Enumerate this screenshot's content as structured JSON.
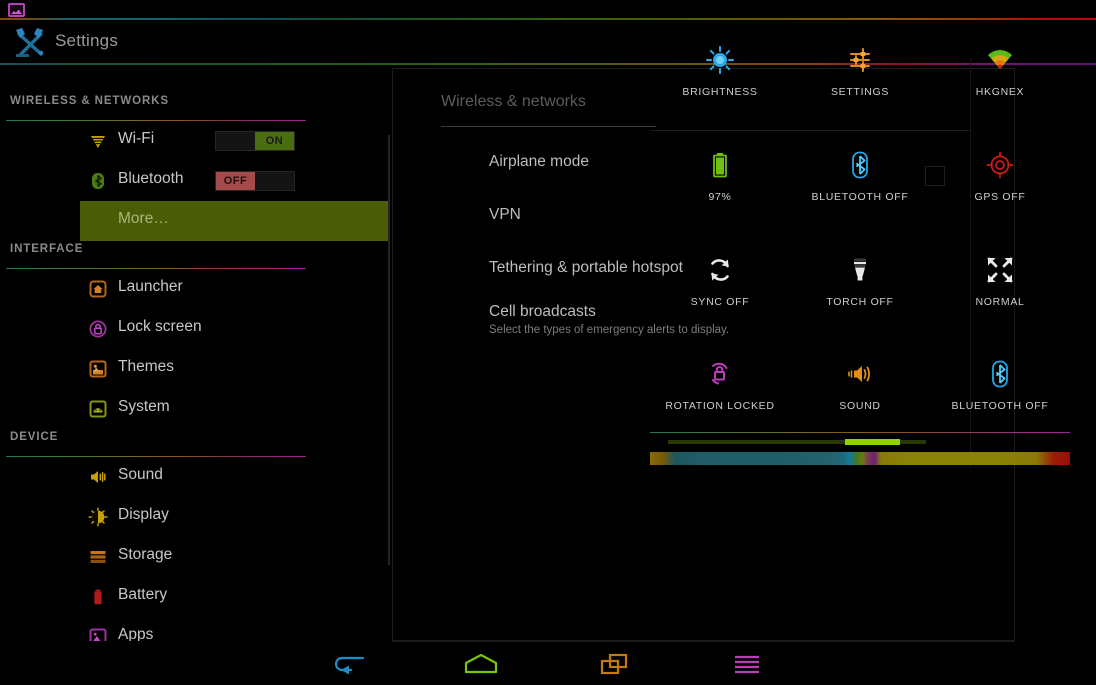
{
  "statusbar": {
    "icon": "gallery-image-icon"
  },
  "actionbar": {
    "icon": "settings-tools-icon",
    "title": "Settings"
  },
  "sidebar": {
    "sections": [
      {
        "header": "WIRELESS & NETWORKS",
        "items": [
          {
            "label": "Wi-Fi",
            "icon": "wifi-icon",
            "toggle": "ON"
          },
          {
            "label": "Bluetooth",
            "icon": "bluetooth-icon",
            "toggle": "OFF"
          },
          {
            "label": "More…",
            "icon": "none",
            "toggle": null,
            "active": true
          }
        ]
      },
      {
        "header": "INTERFACE",
        "items": [
          {
            "label": "Launcher",
            "icon": "launcher-home-icon"
          },
          {
            "label": "Lock screen",
            "icon": "lock-icon"
          },
          {
            "label": "Themes",
            "icon": "themes-picture-icon"
          },
          {
            "label": "System",
            "icon": "system-android-icon"
          }
        ]
      },
      {
        "header": "DEVICE",
        "items": [
          {
            "label": "Sound",
            "icon": "sound-speaker-icon"
          },
          {
            "label": "Display",
            "icon": "display-brightness-icon"
          },
          {
            "label": "Storage",
            "icon": "storage-icon"
          },
          {
            "label": "Battery",
            "icon": "battery-icon"
          },
          {
            "label": "Apps",
            "icon": "apps-picture-icon"
          }
        ]
      }
    ]
  },
  "content": {
    "title": "Wireless & networks",
    "prefs": [
      {
        "title": "Airplane mode",
        "sub": null
      },
      {
        "title": "VPN",
        "sub": null
      },
      {
        "title": "Tethering & portable hotspot",
        "sub": null
      },
      {
        "title": "Cell broadcasts",
        "sub": "Select the types of emergency alerts to display."
      }
    ]
  },
  "quick_settings": {
    "tiles": [
      {
        "label": "BRIGHTNESS",
        "icon": "brightness-sun-icon",
        "row": 0,
        "col": 0
      },
      {
        "label": "SETTINGS",
        "icon": "sliders-settings-icon",
        "row": 0,
        "col": 1
      },
      {
        "label": "HKGNEX",
        "icon": "wifi-signal-icon",
        "row": 0,
        "col": 2
      },
      {
        "label": "97%",
        "icon": "battery-full-icon",
        "row": 1,
        "col": 0
      },
      {
        "label": "BLUETOOTH OFF",
        "icon": "bluetooth-icon",
        "row": 1,
        "col": 1
      },
      {
        "label": "GPS OFF",
        "icon": "gps-crosshair-icon",
        "row": 1,
        "col": 2
      },
      {
        "label": "SYNC OFF",
        "icon": "sync-refresh-icon",
        "row": 2,
        "col": 0
      },
      {
        "label": "TORCH OFF",
        "icon": "torch-flashlight-icon",
        "row": 2,
        "col": 1
      },
      {
        "label": "NORMAL",
        "icon": "expand-arrows-icon",
        "row": 2,
        "col": 2
      },
      {
        "label": "ROTATION LOCKED",
        "icon": "rotation-lock-icon",
        "row": 3,
        "col": 0
      },
      {
        "label": "SOUND",
        "icon": "volume-sound-icon",
        "row": 3,
        "col": 1
      },
      {
        "label": "BLUETOOTH OFF",
        "icon": "bluetooth-icon",
        "row": 3,
        "col": 2
      }
    ],
    "brightness_slider": {
      "value_percent": 72
    }
  },
  "navbar": {
    "buttons": [
      {
        "name": "back",
        "icon": "back-arrow-icon",
        "color": "#1a8fc4"
      },
      {
        "name": "home",
        "icon": "home-icon",
        "color": "#7ac40f"
      },
      {
        "name": "recents",
        "icon": "recents-icon",
        "color": "#c47a0f"
      },
      {
        "name": "menu",
        "icon": "menu-icon",
        "color": "#b83fb8"
      }
    ]
  }
}
